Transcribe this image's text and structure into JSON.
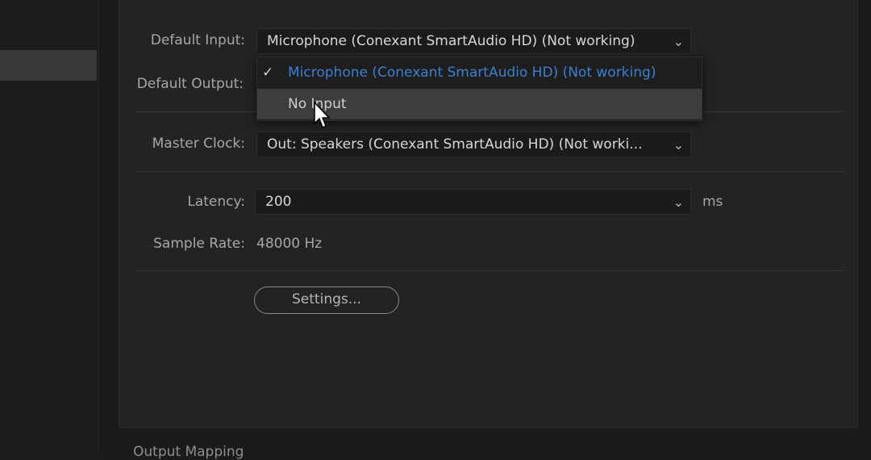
{
  "form": {
    "default_input": {
      "label": "Default Input:",
      "value": "Microphone (Conexant SmartAudio HD) (Not working)"
    },
    "default_output": {
      "label": "Default Output:"
    },
    "master_clock": {
      "label": "Master Clock:",
      "value": "Out: Speakers (Conexant SmartAudio HD) (Not worki..."
    },
    "latency": {
      "label": "Latency:",
      "value": "200",
      "unit": "ms"
    },
    "sample_rate": {
      "label": "Sample Rate:",
      "value": "48000 Hz"
    },
    "settings_button": "Settings..."
  },
  "dropdown_menu": {
    "items": [
      {
        "label": "Microphone (Conexant SmartAudio HD) (Not working)",
        "checked": true
      },
      {
        "label": "No Input",
        "checked": false
      }
    ]
  },
  "footer": {
    "section_label": "Output Mapping"
  },
  "colors": {
    "accent_selected": "#3d7fd2",
    "background": "#1b1b1b",
    "panel": "#232323"
  },
  "icons": {
    "chevron": "chevron-down-icon",
    "check": "checkmark-icon",
    "cursor": "mouse-pointer-icon"
  }
}
